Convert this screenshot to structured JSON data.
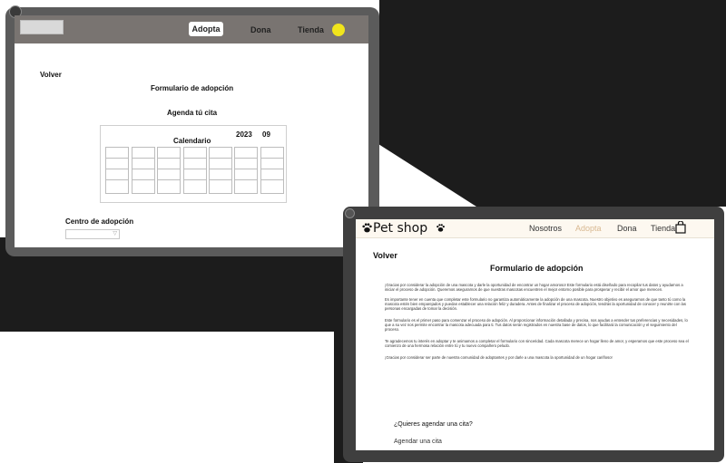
{
  "old_site": {
    "nav": {
      "items": [
        {
          "label": "Adopta",
          "active": true
        },
        {
          "label": "Dona",
          "active": false
        },
        {
          "label": "Tienda",
          "active": false
        }
      ],
      "accent": "#f1e51c",
      "bar_color": "#797471"
    },
    "back_label": "Volver",
    "form_title": "Formulario de adopción",
    "subtitle": "Agenda tú cita",
    "calendar": {
      "title": "Calendario",
      "year": "2023",
      "month": "09"
    },
    "center_label": "Centro de adopción",
    "select_arrow": "▽"
  },
  "new_site": {
    "logo": "Pet shop",
    "nav": {
      "items": [
        {
          "label": "Nosotros",
          "active": false
        },
        {
          "label": "Adopta",
          "active": true
        },
        {
          "label": "Dona",
          "active": false
        },
        {
          "label": "Tienda",
          "active": false
        }
      ],
      "active_color": "#d8b890",
      "bar_color": "#fdf8f0"
    },
    "back_label": "Volver",
    "form_title": "Formulario de adopción",
    "paragraphs": [
      "¡Gracias por considerar la adopción de una mascota y darle la oportunidad de encontrar un hogar amoroso! Este formulario está diseñado para recopilar tus datos y ayudarnos a iniciar el proceso de adopción. Queremos asegurarnos de que nuestras mascotas encuentren el mejor entorno posible para prosperar y recibir el amor que merecen.",
      "Es importante tener en cuenta que completar este formulario no garantiza automáticamente la adopción de una mascota. Nuestro objetivo es asegurarnos de que tanto tú como la mascota estén bien emparejados y puedan establecer una relación feliz y duradera. Antes de finalizar el proceso de adopción, tendrás la oportunidad de conocer y reunirte con las personas encargadas de tomar la decisión.",
      "Este formulario es el primer paso para comenzar el proceso de adopción. Al proporcionar información detallada y precisa, nos ayudas a entender tus preferencias y necesidades, lo que a su vez nos permite encontrar la mascota adecuada para ti. Tus datos serán registrados en nuestra base de datos, lo que facilitará la comunicación y el seguimiento del proceso.",
      "Te agradecemos tu interés en adoptar y te animamos a completar el formulario con sinceridad. Cada mascota merece un hogar lleno de amor, y esperamos que este proceso sea el comienzo de una hermosa relación entre tú y tu nuevo compañero peludo.",
      "¡Gracias por considerar ser parte de nuestra comunidad de adoptantes y por darle a una mascota la oportunidad de un hogar cariñoso!"
    ],
    "question": "¿Quieres agendar una cita?",
    "cta_label": "Agendar una cita"
  }
}
